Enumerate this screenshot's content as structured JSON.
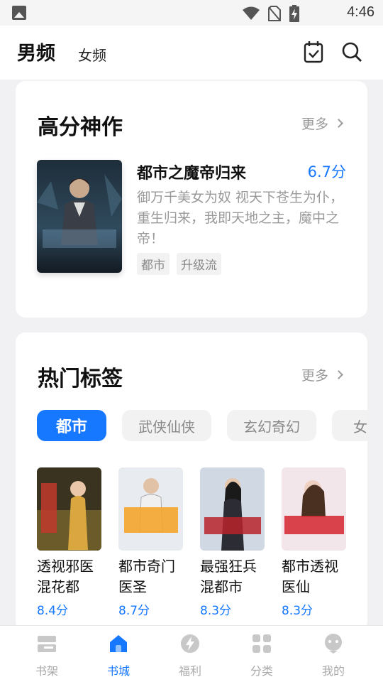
{
  "status_bar": {
    "time": "4:46"
  },
  "header": {
    "tab_male": "男频",
    "tab_female": "女频",
    "icons": [
      "calendar-check-icon",
      "search-icon"
    ]
  },
  "high_score": {
    "title": "高分神作",
    "more": "更多",
    "book": {
      "title": "都市之魔帝归来",
      "score": "6.7分",
      "desc": "御万千美女为奴 视天下苍生为仆，重生归来，我即天地之主，魔中之帝！",
      "tags": [
        "都市",
        "升级流"
      ]
    }
  },
  "hot_tags": {
    "title": "热门标签",
    "more": "更多",
    "chips": [
      "都市",
      "武侠仙侠",
      "玄幻奇幻",
      "女频"
    ],
    "active_chip": 0,
    "books": [
      {
        "title": "透视邪医混花都",
        "score": "8.4分"
      },
      {
        "title": "都市奇门医圣",
        "score": "8.7分"
      },
      {
        "title": "最强狂兵混都市",
        "score": "8.3分"
      },
      {
        "title": "都市透视医仙",
        "score": "8.3分"
      }
    ]
  },
  "bottom_nav": {
    "items": [
      {
        "label": "书架",
        "icon": "bookshelf-icon"
      },
      {
        "label": "书城",
        "icon": "home-icon"
      },
      {
        "label": "福利",
        "icon": "lightning-icon"
      },
      {
        "label": "分类",
        "icon": "category-icon"
      },
      {
        "label": "我的",
        "icon": "profile-icon"
      }
    ],
    "active": 1
  },
  "colors": {
    "accent": "#1677ff",
    "background": "#f1f1f3"
  }
}
